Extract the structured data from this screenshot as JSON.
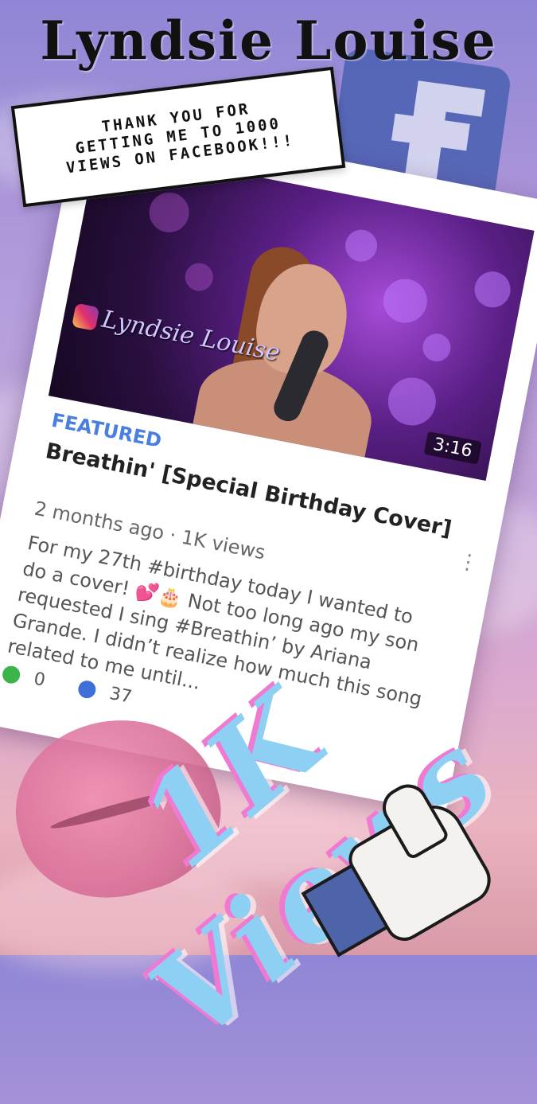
{
  "title": "Lyndsie Louise",
  "banner": {
    "line1": "THANK YOU FOR",
    "line2": "GETTING ME TO 1000",
    "line3": "VIEWS ON FACEBOOK!!!"
  },
  "card": {
    "watermark": "Lyndsie Louise",
    "duration": "3:16",
    "featured": "FEATURED",
    "video_title": "Breathin' [Special Birthday Cover]",
    "meta": "2 months ago · 1K views",
    "description": "For my 27th #birthday today I wanted to do a cover! 💕🎂 Not too long ago my son requested I sing #Breathin’ by Ariana Grande. I didn’t realize how much this song related to me until...",
    "comments": "0",
    "shares": "37"
  },
  "views_text": "1K Views",
  "colors": {
    "accent": "#4a7fe0",
    "views_fill": "#8dd0f3",
    "views_shadow": "#f07ad1",
    "fb": "#4d62b3"
  },
  "icons": [
    "facebook-icon",
    "instagram-icon",
    "comment-icon",
    "share-icon",
    "more-icon",
    "thumbs-up-icon",
    "lips-icon"
  ]
}
